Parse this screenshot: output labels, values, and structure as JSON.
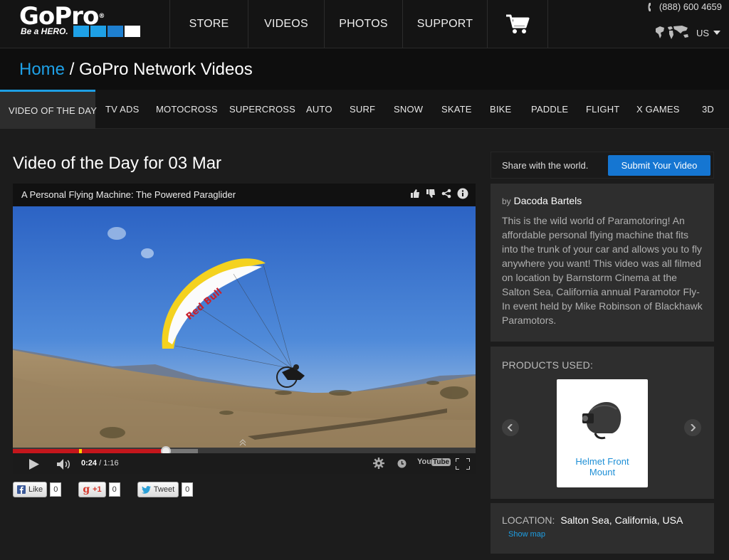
{
  "brand": {
    "logo_text": "GoPro",
    "tagline": "Be a HERO.",
    "colors": {
      "accent": "#1ea0e6",
      "red": "#c4161c",
      "submit": "#1576d2"
    }
  },
  "header": {
    "nav": [
      "STORE",
      "VIDEOS",
      "PHOTOS",
      "SUPPORT"
    ],
    "cart_icon": "shopping-cart-icon",
    "phone": "(888) 600 4659",
    "locale": "US"
  },
  "breadcrumb": {
    "home": "Home",
    "separator": "/",
    "current": "GoPro Network Videos"
  },
  "categories": [
    "VIDEO OF THE DAY",
    "TV ADS",
    "MOTOCROSS",
    "SUPERCROSS",
    "AUTO",
    "SURF",
    "SNOW",
    "SKATE",
    "BIKE",
    "PADDLE",
    "FLIGHT",
    "X GAMES",
    "3D"
  ],
  "main": {
    "title": "Video of the Day for 03 Mar",
    "player": {
      "video_title": "A Personal Flying Machine: The Powered Paraglider",
      "current_time": "0:24",
      "duration": "1:16",
      "time_separator": "/",
      "played_fraction": 0.33,
      "buffered_fraction": 0.4,
      "youtube_label": "YouTube"
    },
    "social": {
      "like_label": "Like",
      "like_count": "0",
      "gplus_label": "+1",
      "gplus_count": "0",
      "tweet_label": "Tweet",
      "tweet_count": "0"
    }
  },
  "sidebar": {
    "share_text": "Share with the world.",
    "submit_label": "Submit Your Video",
    "by_prefix": "by",
    "author": "Dacoda Bartels",
    "description": "This is the wild world of Paramotoring! An affordable personal flying machine that fits into the trunk of your car and allows you to fly anywhere you want! This video was all filmed on location by Barnstorm Cinema at the Salton Sea, California annual Paramotor Fly-In event held by Mike Robinson of Blackhawk Paramotors.",
    "products_label": "PRODUCTS USED:",
    "product_name_line1": "Helmet Front",
    "product_name_line2": "Mount",
    "location_label": "LOCATION:",
    "location_value": "Salton Sea, California, USA",
    "show_map": "Show map"
  }
}
